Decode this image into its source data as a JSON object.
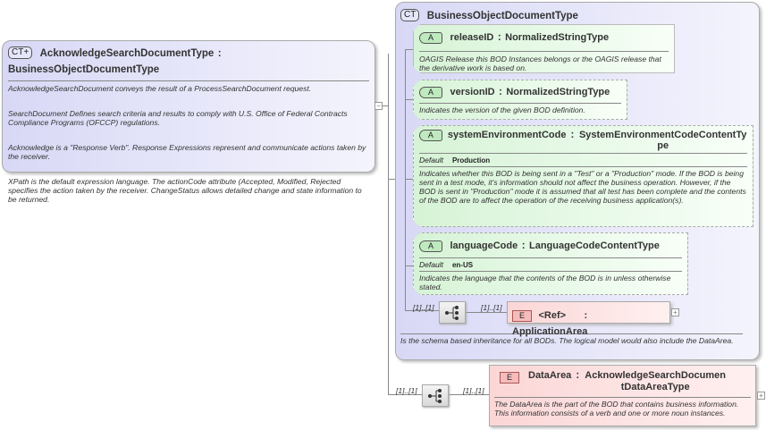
{
  "root": {
    "badge": "CT+",
    "name": "AcknowledgeSearchDocumentType",
    "sep": ":",
    "base": "BusinessObjectDocumentType",
    "desc": [
      "AcknowledgeSearchDocument conveys the result of a ProcessSearchDocument request.",
      "SearchDocument  Defines search criteria and results to comply with U.S. Office of Federal Contracts Compliance Programs (OFCCP) regulations.",
      " Acknowledge is a \"Response Verb\". Response Expressions represent and communicate actions taken by the receiver.",
      " XPath is the default expression language. The actionCode attribute (Accepted, Modified, Rejected specifies the action taken by the receiver. ChangeStatus allows detailed change and state information to be returned."
    ],
    "collapse": "−"
  },
  "base": {
    "badge": "CT",
    "name": "BusinessObjectDocumentType",
    "desc": "Is the schema based inheritance for all BODs. The logical model would also include the DataArea."
  },
  "attributes": [
    {
      "badge": "A",
      "name": "releaseID",
      "type": "NormalizedStringType",
      "desc": "OAGIS Release this BOD Instances belongs or the OAGIS release that the derivative work is based on."
    },
    {
      "badge": "A",
      "name": "versionID",
      "type": "NormalizedStringType",
      "desc": "Indicates the version of the given BOD definition."
    },
    {
      "badge": "A",
      "name": "systemEnvironmentCode",
      "type": "SystemEnvironmentCodeContentType",
      "default_label": "Default",
      "default": "Production",
      "desc": "Indicates whether this BOD is being sent in a \"Test\" or a \"Production\" mode. If the BOD is being sent in a test mode, it's information should not affect the business operation. However, if the BOD is sent in \"Production\" mode it is assumed that all test has been complete and the contents of the BOD are to affect the operation of the receiving business application(s)."
    },
    {
      "badge": "A",
      "name": "languageCode",
      "type": "LanguageCodeContentType",
      "default_label": "Default",
      "default": "en-US",
      "desc": "Indicates the language that the contents of the BOD is in unless otherwise stated."
    }
  ],
  "appArea": {
    "badge": "E",
    "ref": "<Ref>",
    "name": ": ApplicationArea",
    "card_in": "[1]..[1]",
    "card_out": "[1]..[1]",
    "expand": "+"
  },
  "dataArea": {
    "badge": "E",
    "name": "DataArea",
    "sep": ":",
    "type": "AcknowledgeSearchDocumentDataAreaType",
    "card_in": "[1]..[1]",
    "card_out": "[1]..[1]",
    "expand": "+",
    "desc": "The DataArea is the part of the BOD that contains business information. This information consists of a verb and one or more noun instances."
  }
}
